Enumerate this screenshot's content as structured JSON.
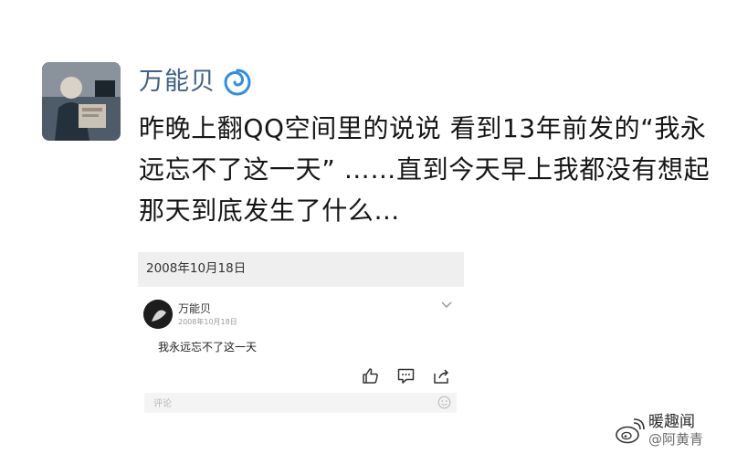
{
  "post": {
    "author": "万能贝",
    "badge_icon": "swirl-badge-icon",
    "text": "昨晚上翻QQ空间里的说说 看到13年前发的“我永远忘不了这一天” ……直到今天早上我都没有想起那天到底发生了什么…"
  },
  "embedded_screenshot": {
    "date_header": "2008年10月18日",
    "author": "万能贝",
    "post_date": "2008年10月18日",
    "content": "我永远忘不了这一天",
    "actions": [
      "like-icon",
      "comment-icon",
      "share-icon"
    ],
    "comment_placeholder": "评论"
  },
  "watermark": {
    "line1": "暖趣闻",
    "line2": "@阿黄青"
  },
  "colors": {
    "author_name": "#3f6189",
    "badge": "#2f8de4",
    "text": "#161616"
  }
}
